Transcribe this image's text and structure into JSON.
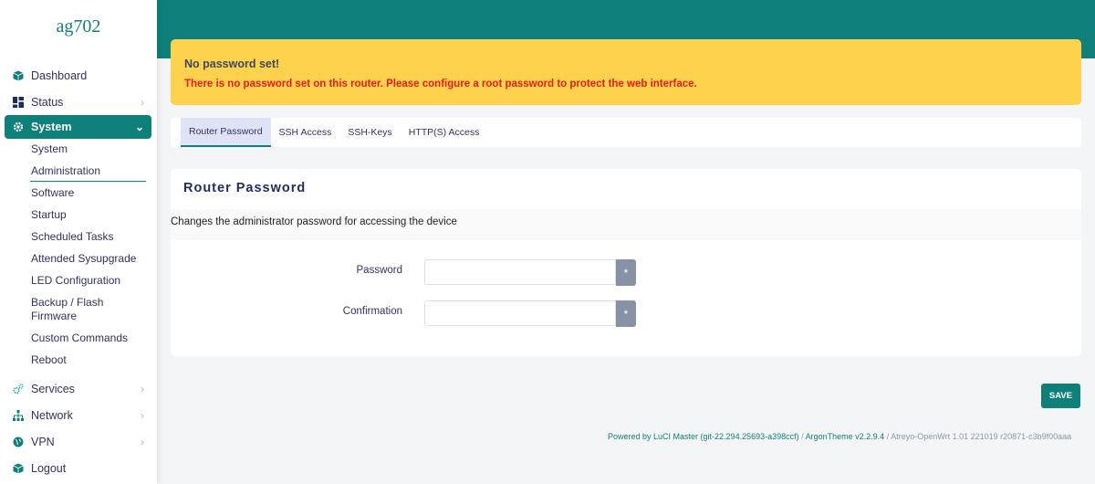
{
  "brand": "ag702",
  "sidebar": {
    "items": [
      {
        "label": "Dashboard",
        "icon": "box-icon"
      },
      {
        "label": "Status",
        "icon": "grid-icon"
      },
      {
        "label": "System",
        "icon": "gear-icon"
      },
      {
        "label": "Services",
        "icon": "gears-icon"
      },
      {
        "label": "Network",
        "icon": "network-icon"
      },
      {
        "label": "VPN",
        "icon": "globe-icon"
      },
      {
        "label": "Logout",
        "icon": "box-icon"
      }
    ],
    "system_sub": [
      "System",
      "Administration",
      "Software",
      "Startup",
      "Scheduled Tasks",
      "Attended Sysupgrade",
      "LED Configuration",
      "Backup / Flash",
      "Firmware",
      "Custom Commands",
      "Reboot"
    ]
  },
  "alert": {
    "title": "No password set!",
    "message": "There is no password set on this router. Please configure a root password to protect the web interface."
  },
  "tabs": [
    "Router Password",
    "SSH Access",
    "SSH-Keys",
    "HTTP(S) Access"
  ],
  "card": {
    "title": "Router Password",
    "description": "Changes the administrator password for accessing the device",
    "fields": [
      {
        "label": "Password",
        "value": "",
        "reveal": "*"
      },
      {
        "label": "Confirmation",
        "value": "",
        "reveal": "*"
      }
    ]
  },
  "save_label": "SAVE",
  "footer": {
    "powered": "Powered by LuCI Master (git-22.294.25693-a398ccf)",
    "sep1": " / ",
    "theme": "ArgonTheme v2.2.9.4",
    "sep2": " / ",
    "build": "Atreyo-OpenWrt 1.01 221019 r20871-c3b9f00aaa"
  },
  "colors": {
    "accent": "#0f7f7a",
    "alert_bg": "#ffd24d",
    "alert_text": "#e41b1b"
  }
}
